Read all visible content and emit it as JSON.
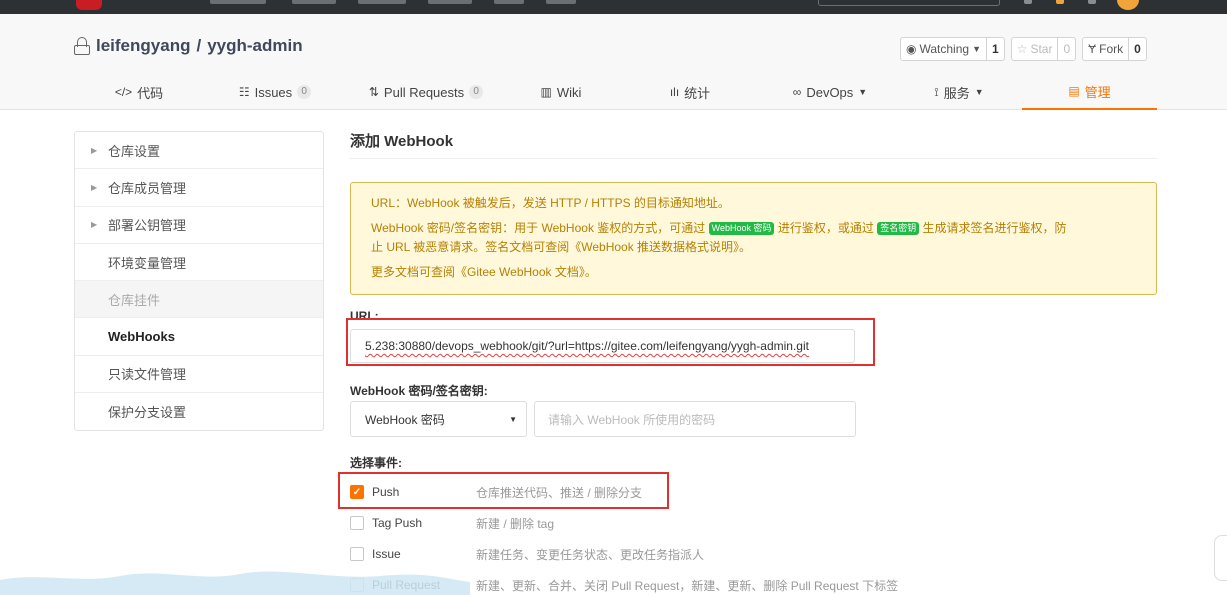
{
  "repo": {
    "owner": "leifengyang",
    "separator": "/",
    "name": "yygh-admin"
  },
  "actions": {
    "watch_label": "Watching",
    "watch_count": "1",
    "star_label": "Star",
    "star_count": "0",
    "fork_label": "Fork",
    "fork_count": "0"
  },
  "tabs": [
    {
      "icon": "</>",
      "label": "代码"
    },
    {
      "icon": "☷",
      "label": "Issues",
      "badge": "0"
    },
    {
      "icon": "⇅",
      "label": "Pull Requests",
      "badge": "0"
    },
    {
      "icon": "▥",
      "label": "Wiki"
    },
    {
      "icon": "ılı",
      "label": "统计"
    },
    {
      "icon": "∞",
      "label": "DevOps"
    },
    {
      "icon": "⟟",
      "label": "服务"
    },
    {
      "icon": "▤",
      "label": "管理"
    }
  ],
  "sidebar": {
    "items": [
      {
        "label": "仓库设置"
      },
      {
        "label": "仓库成员管理"
      },
      {
        "label": "部署公钥管理"
      },
      {
        "label": "环境变量管理"
      },
      {
        "label": "仓库挂件"
      },
      {
        "label": "WebHooks"
      },
      {
        "label": "只读文件管理"
      },
      {
        "label": "保护分支设置"
      }
    ]
  },
  "main": {
    "title": "添加 WebHook",
    "notice": {
      "line1": "URL：WebHook 被触发后，发送 HTTP / HTTPS 的目标通知地址。",
      "line2_a": "WebHook 密码/签名密钥：用于 WebHook 鉴权的方式，可通过",
      "tag1": "WebHook 密码",
      "line2_b": "进行鉴权，或通过",
      "tag2": "签名密钥",
      "line2_c": "生成请求签名进行鉴权，防",
      "line2_d": "止 URL 被恶意请求。签名文档可查阅",
      "link1": "《WebHook 推送数据格式说明》",
      "line2_e": "。",
      "line3_a": "更多文档可查阅",
      "link2": "《Gitee WebHook 文档》",
      "line3_b": "。"
    },
    "url_label": "URL:",
    "url_value": "5.238:30880/devops_webhook/git/?url=https://gitee.com/leifengyang/yygh-admin.git",
    "secret_label": "WebHook 密码/签名密钥:",
    "secret_type": "WebHook 密码",
    "secret_placeholder": "请输入 WebHook 所使用的密码",
    "events_label": "选择事件:",
    "events": [
      {
        "name": "Push",
        "desc": "仓库推送代码、推送 / 删除分支",
        "checked": true
      },
      {
        "name": "Tag Push",
        "desc": "新建 / 删除 tag",
        "checked": false
      },
      {
        "name": "Issue",
        "desc": "新建任务、变更任务状态、更改任务指派人",
        "checked": false
      },
      {
        "name": "Pull Request",
        "desc": "新建、更新、合并、关闭 Pull Request，新建、更新、删除 Pull Request 下标签",
        "checked": false
      }
    ]
  },
  "colors": {
    "accent": "#fe7300",
    "highlight_box": "#e03030",
    "notice_bg": "#fff8db",
    "notice_text": "#b58105",
    "tag_green": "#21ba45"
  }
}
